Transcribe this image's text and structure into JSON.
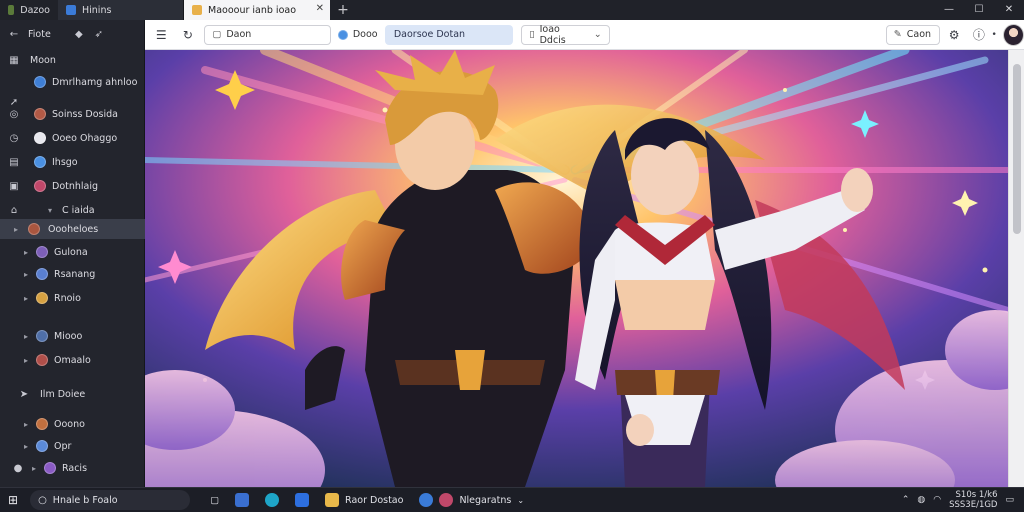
{
  "titlebar": {
    "app_label": "Dazoo",
    "sidebar_tab_label": "Hinins",
    "active_tab_label": "Maooour ianb ioao",
    "new_tab_symbol": "+"
  },
  "sidebar": {
    "back_label": "Fiote",
    "section_header": "Moon",
    "items": [
      {
        "label": "Dmrlhamg ahnloo"
      },
      {
        "label": "Soinss Dosida"
      },
      {
        "label": "Ooeo Ohaggo"
      },
      {
        "label": "Ihsgo"
      },
      {
        "label": "Dotnhlaig"
      },
      {
        "label": "C iaida"
      },
      {
        "label": "Oooheloes"
      },
      {
        "label": "Gulona"
      },
      {
        "label": "Rsanang"
      },
      {
        "label": "Rnoio"
      },
      {
        "label": "Miooo"
      },
      {
        "label": "Omaalo"
      },
      {
        "label": "Ilm Doiee"
      },
      {
        "label": "Ooono"
      },
      {
        "label": "Opr"
      },
      {
        "label": "Racis"
      }
    ]
  },
  "toolbar": {
    "address_value": "Daon",
    "dropdown_value": "Dooo",
    "pill_label": "Daorsoe Dotan",
    "search_value": "Ioao Ddcis",
    "action_label": "Caon"
  },
  "taskbar": {
    "search_label": "Hnale b Foalo",
    "item1_label": "Raor Dostao",
    "item2_label": "Nlegaratns",
    "clock_time": "S10s 1/k6",
    "clock_date": "SSS3E/1GD"
  },
  "colors": {
    "accent": "#dbe6f7",
    "sidebar_bg": "#23252d",
    "selected_row": "#3a3e4a"
  }
}
